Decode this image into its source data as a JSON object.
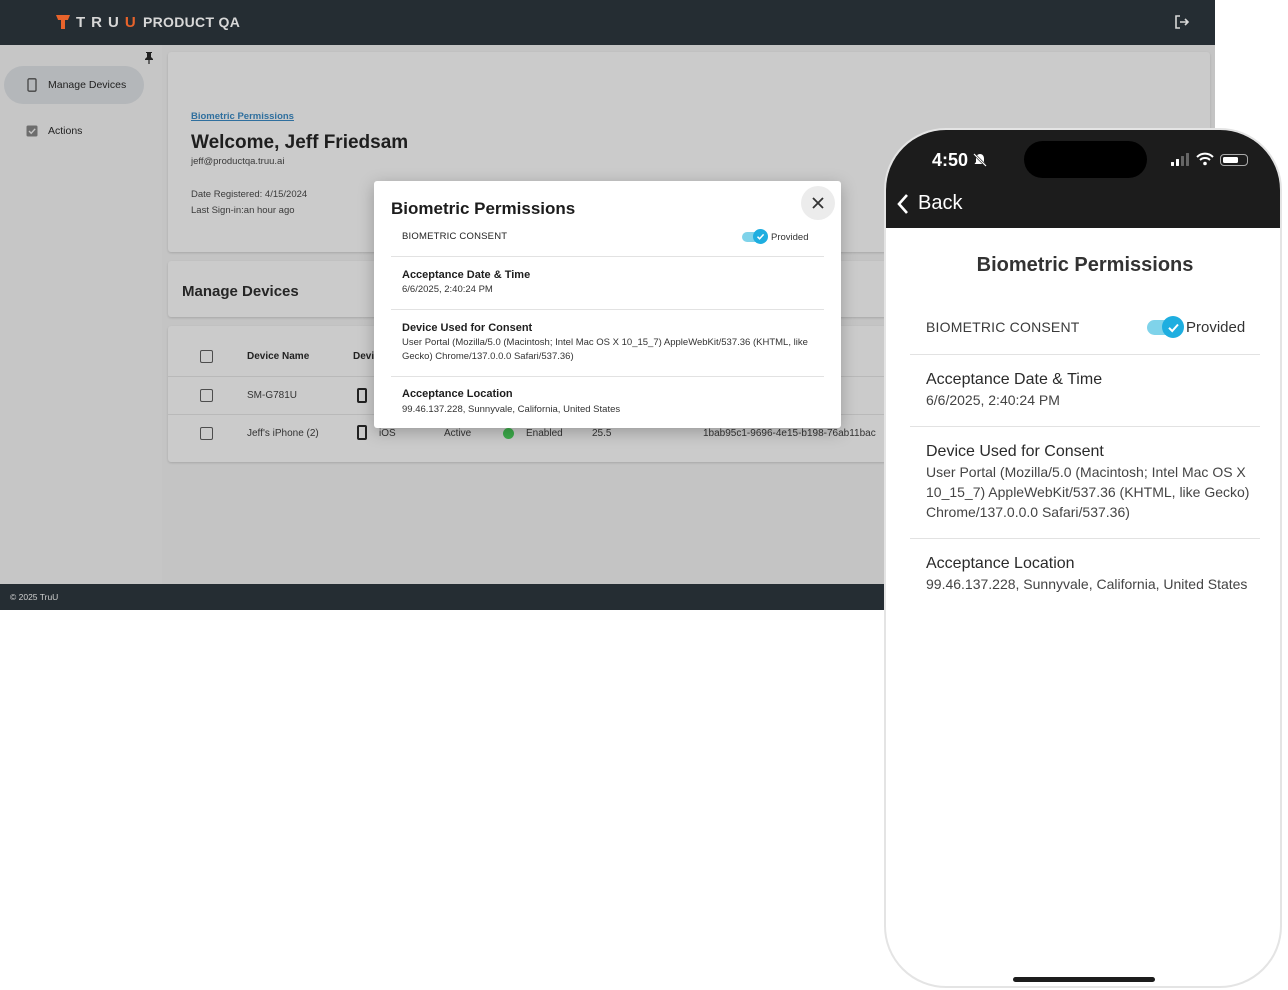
{
  "header": {
    "logo_text_a": "TRU",
    "logo_text_b": "U",
    "org_name": "PRODUCT QA",
    "logout_icon": "logout-icon"
  },
  "sidebar": {
    "items": [
      {
        "label": "Manage Devices",
        "icon": "phone-icon",
        "active": true
      },
      {
        "label": "Actions",
        "icon": "checkbox-icon",
        "active": false
      }
    ]
  },
  "profile": {
    "breadcrumb": "Biometric Permissions",
    "welcome": "Welcome, Jeff Friedsam",
    "email": "jeff@productqa.truu.ai",
    "date_registered": "Date Registered: 4/15/2024",
    "last_sign_in": "Last Sign-in:an hour ago"
  },
  "manage": {
    "title": "Manage Devices"
  },
  "table": {
    "headers": [
      "Device Name",
      "Devi"
    ],
    "rows": [
      {
        "name": "SM-G781U"
      },
      {
        "name": "Jeff's iPhone (2)",
        "os": "iOS",
        "status": "Active",
        "state": "Enabled",
        "version": "25.5",
        "id": "1bab95c1-9696-4e15-b198-76ab11bac"
      }
    ]
  },
  "footer": {
    "text": "© 2025 TruU"
  },
  "modal": {
    "title": "Biometric Permissions",
    "consent_label": "BIOMETRIC CONSENT",
    "consent_status": "Provided",
    "sections": [
      {
        "heading": "Acceptance Date & Time",
        "value": "6/6/2025, 2:40:24 PM"
      },
      {
        "heading": "Device Used for Consent",
        "value": "User Portal (Mozilla/5.0 (Macintosh; Intel Mac OS X 10_15_7) AppleWebKit/537.36 (KHTML, like Gecko) Chrome/137.0.0.0 Safari/537.36)"
      },
      {
        "heading": "Acceptance Location",
        "value": "99.46.137.228, Sunnyvale, California, United States"
      }
    ]
  },
  "phone": {
    "time": "4:50",
    "back_label": "Back",
    "title": "Biometric Permissions",
    "consent_label": "BIOMETRIC CONSENT",
    "consent_status": "Provided",
    "sections": [
      {
        "heading": "Acceptance Date & Time",
        "value": "6/6/2025, 2:40:24 PM"
      },
      {
        "heading": "Device Used for Consent",
        "value": "User Portal (Mozilla/5.0 (Macintosh; Intel Mac OS X 10_15_7) AppleWebKit/537.36 (KHTML, like Gecko) Chrome/137.0.0.0 Safari/537.36)"
      },
      {
        "heading": "Acceptance Location",
        "value": "99.46.137.228, Sunnyvale, California, United States"
      }
    ]
  },
  "colors": {
    "topbar": "#252d33",
    "brand_orange": "#e8632b",
    "toggle_on": "#1eaee0",
    "status_green": "#3cab4a",
    "link": "#2f6f9e"
  }
}
